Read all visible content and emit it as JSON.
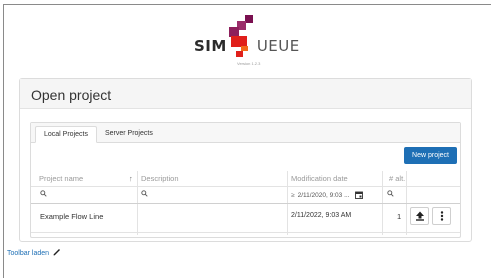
{
  "logo": {
    "part1": "SIM",
    "part2": "UEUE",
    "version": "Version 1.2.3"
  },
  "panel": {
    "title": "Open project"
  },
  "tabs": [
    {
      "label": "Local Projects"
    },
    {
      "label": "Server Projects"
    }
  ],
  "buttons": {
    "new_project": "New project"
  },
  "table": {
    "headers": {
      "name": "Project name",
      "sort": "↑",
      "description": "Description",
      "modification": "Modification date",
      "alt": "# alt."
    },
    "filters": {
      "date_value": "2/11/2020, 9:03 ..."
    },
    "rows": [
      {
        "name": "Example Flow Line",
        "description": "",
        "modified": "2/11/2022, 9:03 AM",
        "alt": "1"
      }
    ]
  },
  "footer": {
    "toolbar_link": "Toolbar laden"
  },
  "colors": {
    "accent": "#1e6fb5",
    "logo_red": "#e0201b",
    "logo_purple": "#7a1050",
    "logo_orange": "#f26a1b"
  }
}
